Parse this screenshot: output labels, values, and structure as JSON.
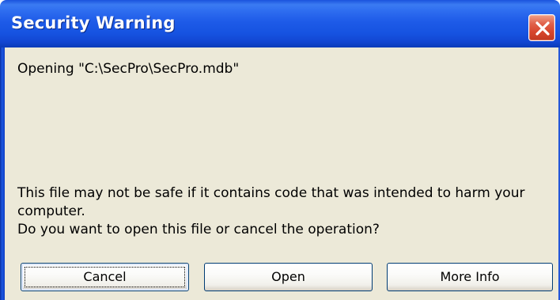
{
  "window": {
    "title": "Security Warning"
  },
  "message": {
    "opening": "Opening \"C:\\SecPro\\SecPro.mdb\"",
    "warning_line1": "This file may not be safe if it contains code that was intended to harm your",
    "warning_line2": "computer.",
    "question": "Do you want to open this file or cancel the operation?"
  },
  "buttons": {
    "cancel": "Cancel",
    "open": "Open",
    "more_info": "More Info"
  },
  "icons": {
    "close": "close-icon"
  },
  "colors": {
    "titlebar": "#1f5ce8",
    "close_button": "#d8472e",
    "dialog_background": "#ece9d8"
  }
}
